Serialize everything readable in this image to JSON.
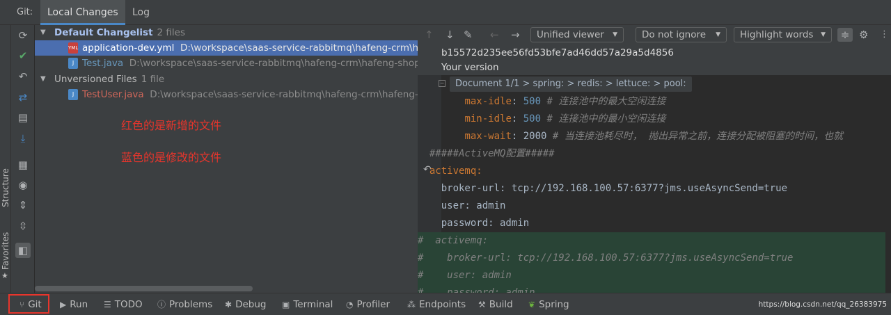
{
  "topbar": {
    "title": "Git:",
    "tabs": [
      {
        "label": "Local Changes"
      },
      {
        "label": "Log"
      }
    ]
  },
  "leftedge": {
    "structure": "Structure",
    "favorites": "Favorites"
  },
  "tree": {
    "default_group": {
      "name": "Default Changelist",
      "count": "2 files"
    },
    "files": [
      {
        "name": "application-dev.yml",
        "path": "D:\\workspace\\saas-service-rabbitmq\\hafeng-crm\\ha",
        "color": "#a0b4e0",
        "icon": "yml-file-icon"
      },
      {
        "name": "Test.java",
        "path": "D:\\workspace\\saas-service-rabbitmq\\hafeng-crm\\hafeng-shop-",
        "color": "#6897bb",
        "icon": "java-file-icon"
      }
    ],
    "unversioned_group": {
      "name": "Unversioned Files",
      "count": "1 file"
    },
    "unversioned": [
      {
        "name": "TestUser.java",
        "path": "D:\\workspace\\saas-service-rabbitmq\\hafeng-crm\\hafeng-s",
        "color": "#d1675a",
        "icon": "java-file-icon"
      }
    ],
    "annotations": [
      "红色的是新增的文件",
      "蓝色的是修改的文件"
    ]
  },
  "diff": {
    "viewer": "Unified viewer",
    "ignore": "Do not ignore",
    "highlight": "Highlight words",
    "hash": "b15572d235ee56fd53bfe7ad46dd57a29a5d4856",
    "version": "Your version",
    "breadcrumb": "Document 1/1 > spring: > redis: > lettuce: > pool:",
    "lines": [
      {
        "indent": "        ",
        "key": "max-idle",
        "value": "500",
        "comment": "# 连接池中的最大空闲连接"
      },
      {
        "indent": "        ",
        "key": "min-idle",
        "value": "500",
        "comment": "# 连接池中的最小空闲连接"
      },
      {
        "indent": "        ",
        "key": "max-wait",
        "value": "2000",
        "comment": " # 当连接池耗尽时， 抛出异常之前，连接分配被阻塞的时间，也就"
      },
      {
        "text": "  #####ActiveMQ配置#####"
      },
      {
        "text": "  activemq:"
      },
      {
        "text": "    broker-url: tcp://192.168.100.57:6377?jms.useAsyncSend=true"
      },
      {
        "text": "    user: admin"
      },
      {
        "text": "    password: admin"
      },
      {
        "text": "#  activemq:"
      },
      {
        "text": "#    broker-url: tcp://192.168.100.57:6377?jms.useAsyncSend=true"
      },
      {
        "text": "#    user: admin"
      },
      {
        "text": "#    password: admin"
      }
    ]
  },
  "bottombar": {
    "tabs": [
      "Git",
      "Run",
      "TODO",
      "Problems",
      "Debug",
      "Terminal",
      "Profiler",
      "Endpoints",
      "Build",
      "Spring"
    ],
    "watermark": "https://blog.csdn.net/qq_26383975"
  },
  "colors": {
    "accent": "#4a88c7",
    "selection": "#4b6eaf",
    "annotation": "#e8352c",
    "added_line": "#294436"
  }
}
